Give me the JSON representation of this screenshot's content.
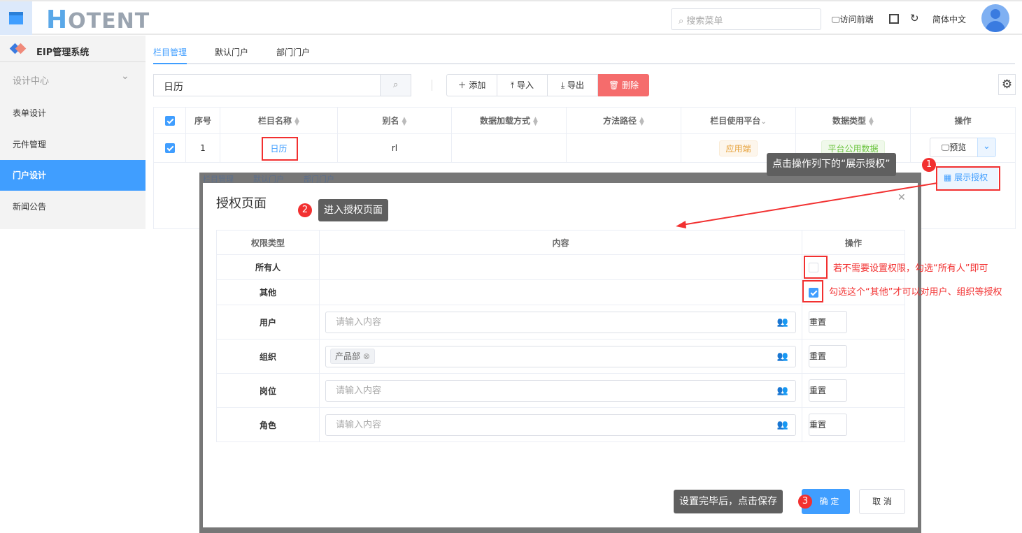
{
  "header": {
    "logo": "HOTENT",
    "search_placeholder": "搜索菜单",
    "visit_frontend": "访问前端",
    "language": "简体中文"
  },
  "sidebar": {
    "system_name": "EIP管理系统",
    "group": "设计中心",
    "items": [
      {
        "label": "表单设计"
      },
      {
        "label": "元件管理"
      },
      {
        "label": "门户设计",
        "active": true
      },
      {
        "label": "新闻公告"
      }
    ]
  },
  "tabs": [
    "栏目管理",
    "默认门户",
    "部门门户"
  ],
  "toolbar": {
    "query": "日历",
    "add": "添加",
    "import": "导入",
    "export": "导出",
    "delete": "删除"
  },
  "table": {
    "columns": [
      "序号",
      "栏目名称",
      "别名",
      "数据加载方式",
      "方法路径",
      "栏目使用平台",
      "数据类型",
      "操作"
    ],
    "rows": [
      {
        "index": "1",
        "name": "日历",
        "alias": "rl",
        "load": "",
        "path": "",
        "platform": "应用端",
        "data_type": "平台公用数据",
        "preview": "预览"
      }
    ],
    "dropdown_item": "展示授权"
  },
  "modal": {
    "title": "授权页面",
    "columns": [
      "权限类型",
      "内容",
      "操作"
    ],
    "rows": [
      {
        "type": "所有人",
        "checked": false
      },
      {
        "type": "其他",
        "checked": true
      },
      {
        "type": "用户",
        "placeholder": "请输入内容",
        "reset": "重置"
      },
      {
        "type": "组织",
        "tag": "产品部",
        "reset": "重置"
      },
      {
        "type": "岗位",
        "placeholder": "请输入内容",
        "reset": "重置"
      },
      {
        "type": "角色",
        "placeholder": "请输入内容",
        "reset": "重置"
      }
    ],
    "confirm": "确 定",
    "cancel": "取 消"
  },
  "annotations": {
    "step1": "点击操作列下的“展示授权”",
    "step2": "进入授权页面",
    "step3": "设置完毕后，点击保存",
    "badge1": "1",
    "badge2": "2",
    "badge3": "3",
    "note_all": "若不需要设置权限，勾选“所有人”即可",
    "note_other": "勾选这个“其他”才可以对用户、组织等授权"
  },
  "colors": {
    "primary": "#409eff",
    "danger": "#f56c6c",
    "annotation": "#f23030"
  }
}
